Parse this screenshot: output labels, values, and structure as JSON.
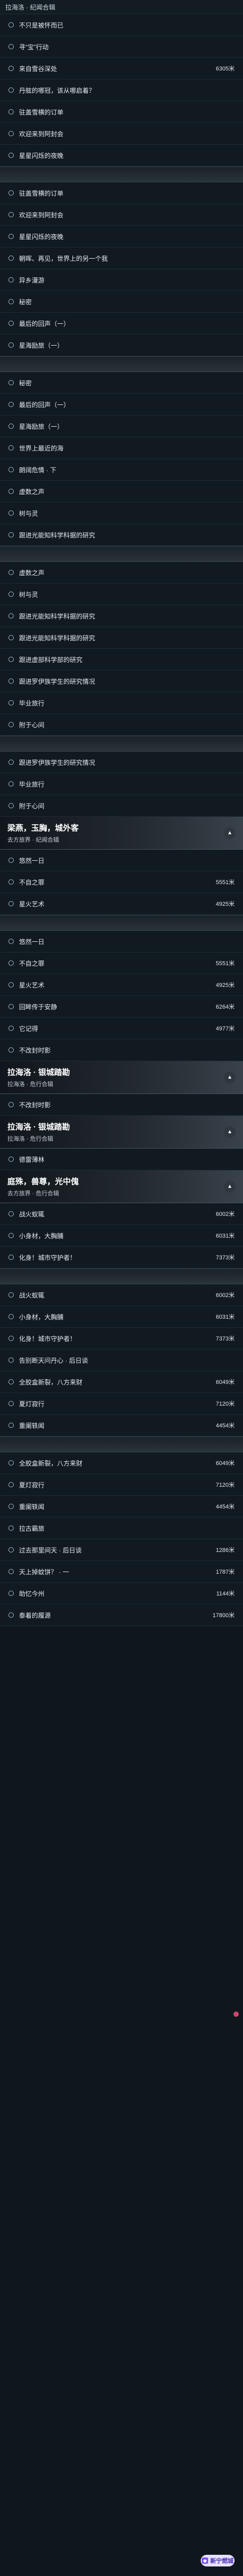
{
  "topbar": {
    "title": "拉海洛 · 纪闻合辑"
  },
  "sections": [
    {
      "kind": "list",
      "rows": [
        {
          "label": "不只是被怀而已",
          "value": ""
        },
        {
          "label": "寻“宝”行动",
          "value": ""
        },
        {
          "label": "来自雪谷深处",
          "value": "6305米"
        },
        {
          "label": "丹舷的哪冠，该从哪启着？",
          "value": ""
        },
        {
          "label": "驻盖雪横的订单",
          "value": ""
        },
        {
          "label": "欢迎来到阿封会",
          "value": ""
        },
        {
          "label": "星星闪烁的夜晚",
          "value": ""
        }
      ]
    },
    {
      "kind": "divider"
    },
    {
      "kind": "list",
      "rows": [
        {
          "label": "驻盖雪横的订单",
          "value": ""
        },
        {
          "label": "欢迎来到阿封会",
          "value": ""
        },
        {
          "label": "星星闪烁的夜晚",
          "value": ""
        },
        {
          "label": "朝晖、再见，世界上的另一个我",
          "value": ""
        },
        {
          "label": "异乡漫游",
          "value": ""
        },
        {
          "label": "秘密",
          "value": ""
        },
        {
          "label": "最后的回声（一）",
          "value": ""
        },
        {
          "label": "星海励旅（一）",
          "value": ""
        }
      ]
    },
    {
      "kind": "divider"
    },
    {
      "kind": "list",
      "rows": [
        {
          "label": "秘密",
          "value": ""
        },
        {
          "label": "最后的回声（一）",
          "value": ""
        },
        {
          "label": "星海励旅（一）",
          "value": ""
        },
        {
          "label": "世界上最近的海",
          "value": ""
        },
        {
          "label": "朗阔危情 · 下",
          "value": ""
        },
        {
          "label": "虚数之声",
          "value": ""
        },
        {
          "label": "树与灵",
          "value": ""
        },
        {
          "label": "跟进光能知科学科据的研究",
          "value": ""
        }
      ]
    },
    {
      "kind": "divider"
    },
    {
      "kind": "list",
      "rows": [
        {
          "label": "虚数之声",
          "value": ""
        },
        {
          "label": "树与灵",
          "value": ""
        },
        {
          "label": "跟进光能知科学科据的研究",
          "value": ""
        },
        {
          "label": "跟进光能知科学科据的研究",
          "value": ""
        },
        {
          "label": "跟进虚部科学部的研究",
          "value": ""
        },
        {
          "label": "跟进罗伊族学生的研究情况",
          "value": ""
        },
        {
          "label": "毕业旅行",
          "value": ""
        },
        {
          "label": "附于心间",
          "value": ""
        }
      ]
    },
    {
      "kind": "divider"
    },
    {
      "kind": "list",
      "rows": [
        {
          "label": "跟进罗伊族学生的研究情况",
          "value": ""
        },
        {
          "label": "毕业旅行",
          "value": ""
        },
        {
          "label": "附于心间",
          "value": ""
        }
      ]
    },
    {
      "kind": "banner",
      "title": "梁燕，玉胸，城外客",
      "sub": "去方旅界 · 纪闻合辑"
    },
    {
      "kind": "list",
      "rows": [
        {
          "label": "悠然一日",
          "value": ""
        },
        {
          "label": "不自之罪",
          "value": "5551米"
        },
        {
          "label": "星火艺术",
          "value": "4925米"
        }
      ]
    },
    {
      "kind": "divider"
    },
    {
      "kind": "list",
      "rows": [
        {
          "label": "悠然一日",
          "value": ""
        },
        {
          "label": "不自之罪",
          "value": "5551米"
        },
        {
          "label": "星火艺术",
          "value": "4925米"
        },
        {
          "label": "回眸传于安静",
          "value": "6264米"
        },
        {
          "label": "它记得",
          "value": "4977米"
        },
        {
          "label": "不改封时影",
          "value": ""
        }
      ]
    },
    {
      "kind": "banner",
      "title": "拉海洛 · 银城踏勘",
      "sub": "拉海洛 · 危行合辑"
    },
    {
      "kind": "list",
      "rows": [
        {
          "label": "不改封时影",
          "value": ""
        }
      ]
    },
    {
      "kind": "banner",
      "title": "拉海洛 · 银城踏勘",
      "sub": "拉海洛 · 危行合辑"
    },
    {
      "kind": "list",
      "rows": [
        {
          "label": "德雷薄林",
          "value": ""
        }
      ]
    },
    {
      "kind": "banner",
      "title": "庭殊，兽尊，光中傀",
      "sub": "去方旅界 · 危行合辑"
    },
    {
      "kind": "list",
      "rows": [
        {
          "label": "战火蚁辄",
          "value": "6002米"
        },
        {
          "label": "小身材，大胸脯",
          "value": "6031米"
        },
        {
          "label": "化身！城市守护者！",
          "value": "7373米"
        }
      ]
    },
    {
      "kind": "divider"
    },
    {
      "kind": "list",
      "rows": [
        {
          "label": "战火蚁辄",
          "value": "6002米"
        },
        {
          "label": "小身材，大胸脯",
          "value": "6031米"
        },
        {
          "label": "化身！城市守护者！",
          "value": "7373米"
        },
        {
          "label": "告别断天问丹心 · 后日谈",
          "value": ""
        },
        {
          "label": "全胶盒新裂，八方来财",
          "value": "6049米"
        },
        {
          "label": "夏灯寂行",
          "value": "7120米"
        },
        {
          "label": "重阑轶闻",
          "value": "4454米"
        }
      ]
    },
    {
      "kind": "divider"
    },
    {
      "kind": "list",
      "rows": [
        {
          "label": "全胶盒新裂，八方来财",
          "value": "6049米"
        },
        {
          "label": "夏灯寂行",
          "value": "7120米"
        },
        {
          "label": "重阑轶闻",
          "value": "4454米"
        },
        {
          "label": "拉古霸旅",
          "value": ""
        },
        {
          "label": "过去那里间天 · 后日谈",
          "value": "1286米"
        },
        {
          "label": "天上掉蚊饼？ · 一",
          "value": "1787米"
        },
        {
          "label": "助忆今州",
          "value": "1144米"
        },
        {
          "label": "泰着的履源",
          "value": "17800米"
        }
      ]
    }
  ],
  "fab": {
    "label": "新宁燃城",
    "icon": "app-icon"
  },
  "colors": {
    "background": "#0f171d",
    "row_divider": "#1d2a33",
    "fab": "#e6e1ff"
  }
}
